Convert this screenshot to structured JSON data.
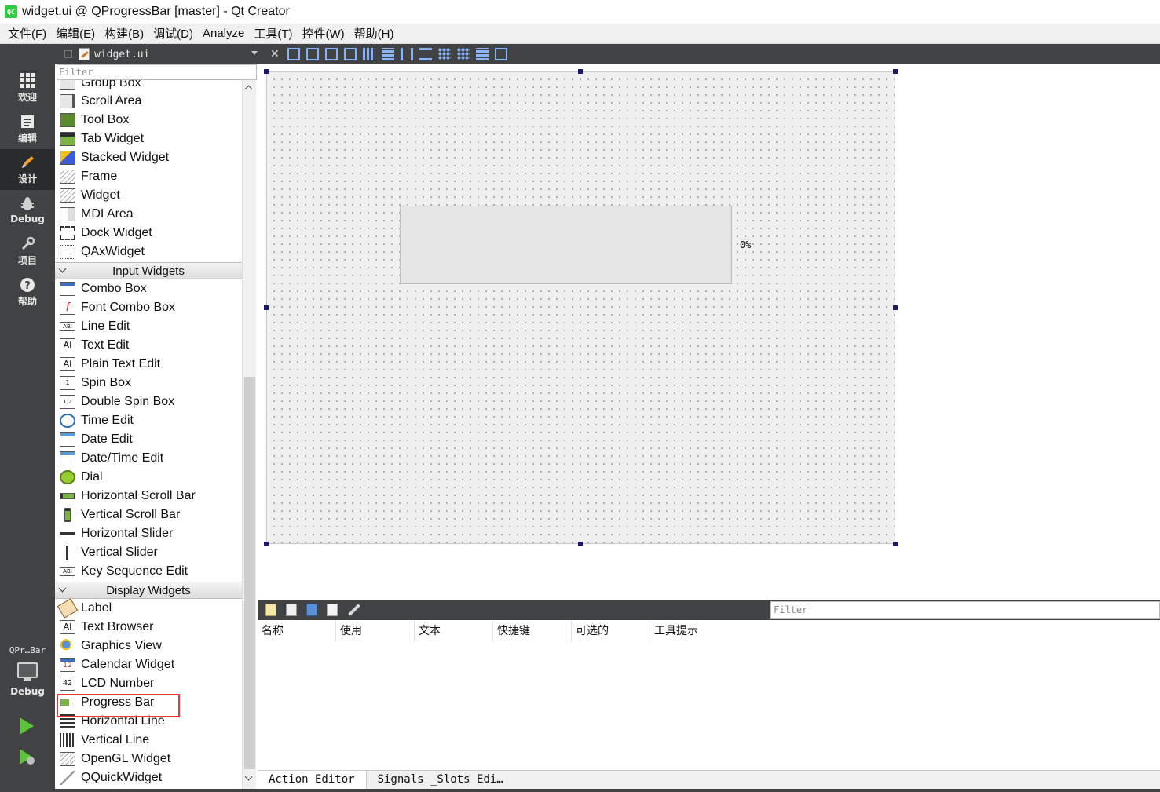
{
  "window": {
    "title": "widget.ui @ QProgressBar [master] - Qt Creator",
    "app_icon_text": "QC"
  },
  "menu": [
    "文件(F)",
    "编辑(E)",
    "构建(B)",
    "调试(D)",
    "Analyze",
    "工具(T)",
    "控件(W)",
    "帮助(H)"
  ],
  "modes": [
    {
      "label": "欢迎",
      "icon": "welcome-grid-icon"
    },
    {
      "label": "编辑",
      "icon": "edit-doc-icon"
    },
    {
      "label": "设计",
      "icon": "design-pen-icon",
      "active": true
    },
    {
      "label": "Debug",
      "icon": "debug-bug-icon"
    },
    {
      "label": "项目",
      "icon": "projects-wrench-icon"
    },
    {
      "label": "帮助",
      "icon": "help-question-icon"
    }
  ],
  "target": {
    "project": "QPr…Bar",
    "config": "Debug"
  },
  "editor": {
    "file_name": "widget.ui"
  },
  "widget_box": {
    "filter_placeholder": "Filter",
    "items_top": [
      "Group Box",
      "Scroll Area",
      "Tool Box",
      "Tab Widget",
      "Stacked Widget",
      "Frame",
      "Widget",
      "MDI Area",
      "Dock Widget",
      "QAxWidget"
    ],
    "category_input": "Input Widgets",
    "items_input": [
      "Combo Box",
      "Font Combo Box",
      "Line Edit",
      "Text Edit",
      "Plain Text Edit",
      "Spin Box",
      "Double Spin Box",
      "Time Edit",
      "Date Edit",
      "Date/Time Edit",
      "Dial",
      "Horizontal Scroll Bar",
      "Vertical Scroll Bar",
      "Horizontal Slider",
      "Vertical Slider",
      "Key Sequence Edit"
    ],
    "category_display": "Display Widgets",
    "items_display": [
      "Label",
      "Text Browser",
      "Graphics View",
      "Calendar Widget",
      "LCD Number",
      "Progress Bar",
      "Horizontal Line",
      "Vertical Line",
      "OpenGL Widget",
      "QQuickWidget"
    ],
    "highlighted_item": "Progress Bar"
  },
  "form": {
    "progress_value": 0,
    "progress_text": "0%"
  },
  "action_editor": {
    "filter_placeholder": "Filter",
    "columns": [
      "名称",
      "使用",
      "文本",
      "快捷键",
      "可选的",
      "工具提示"
    ],
    "tabs": [
      "Action Editor",
      "Signals _Slots Edi…"
    ]
  }
}
